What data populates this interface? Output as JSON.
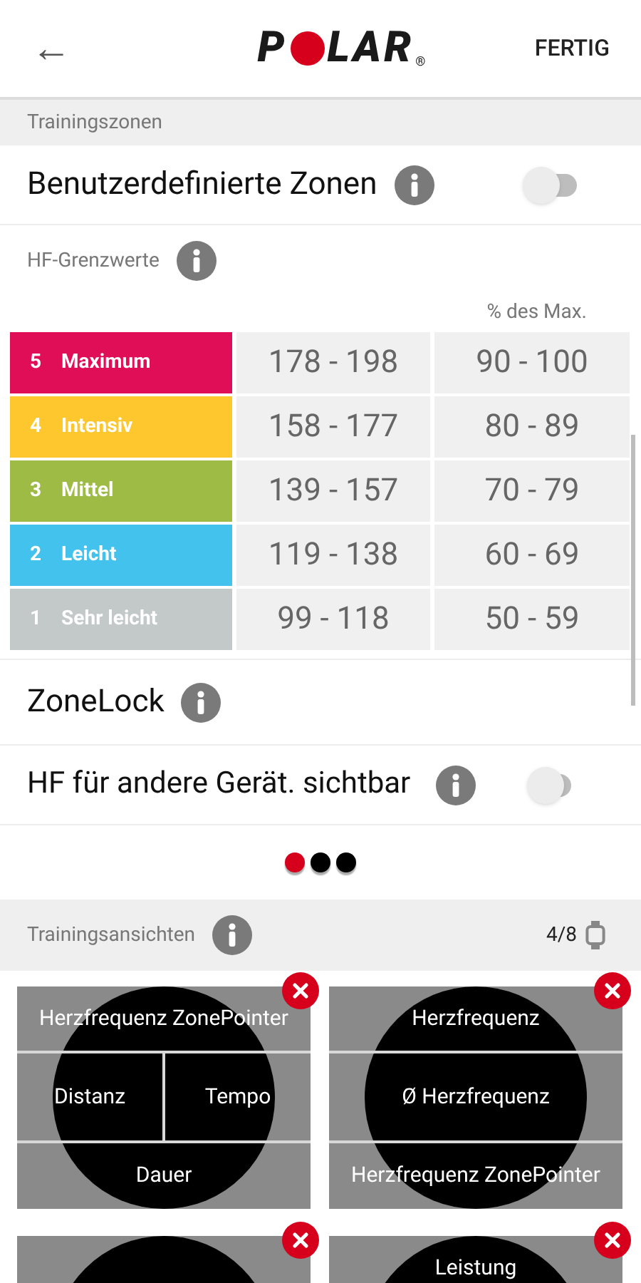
{
  "header": {
    "back": "←",
    "logo": {
      "before": "P",
      "after": "LAR",
      "mark": "®"
    },
    "done": "FERTIG"
  },
  "zones_section": {
    "title": "Trainingszonen"
  },
  "custom_zones": {
    "label": "Benutzerdefinierte Zonen",
    "on": false
  },
  "hr_limits": {
    "label": "HF-Grenzwerte",
    "percent_header": "% des Max.",
    "zones": [
      {
        "number": "5",
        "name": "Maximum",
        "color": "#e00d57",
        "bpm": "178 - 198",
        "percent": "90 - 100"
      },
      {
        "number": "4",
        "name": "Intensiv",
        "color": "#fec72e",
        "bpm": "158 - 177",
        "percent": "80 - 89"
      },
      {
        "number": "3",
        "name": "Mittel",
        "color": "#9dbb45",
        "bpm": "139 - 157",
        "percent": "70 - 79"
      },
      {
        "number": "2",
        "name": "Leicht",
        "color": "#42c2ec",
        "bpm": "119 - 138",
        "percent": "60 - 69"
      },
      {
        "number": "1",
        "name": "Sehr leicht",
        "color": "#c2c9c8",
        "bpm": "99 - 118",
        "percent": "50 - 59"
      }
    ]
  },
  "zonelock": {
    "label": "ZoneLock"
  },
  "hr_visible": {
    "label": "HF für andere Gerät. sichtbar",
    "on": false
  },
  "pager": [
    {
      "selected": true
    },
    {
      "selected": false
    },
    {
      "selected": false
    }
  ],
  "views_section": {
    "title": "Trainingsansichten",
    "count": "4/8"
  },
  "views": [
    {
      "kind": "view",
      "rows": [
        [
          "Herzfrequenz ZonePointer"
        ],
        [
          "Distanz",
          "Tempo"
        ],
        [
          "Dauer"
        ]
      ]
    },
    {
      "kind": "view",
      "rows": [
        [
          "Herzfrequenz"
        ],
        [
          "Ø Herzfrequenz"
        ],
        [
          "Herzfrequenz ZonePointer"
        ]
      ]
    },
    {
      "kind": "view"
    },
    {
      "kind": "view",
      "rows": [
        [
          "Leistung"
        ]
      ]
    }
  ]
}
